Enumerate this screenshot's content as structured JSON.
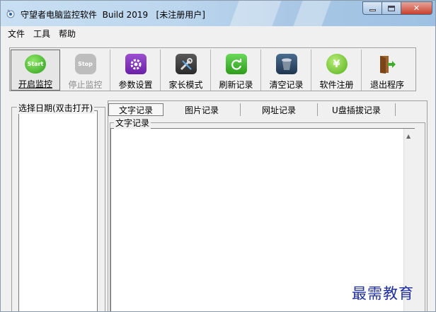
{
  "window": {
    "title": "守望者电脑监控软件  Build 2019   [未注册用户]"
  },
  "menu": [
    "文件",
    "工具",
    "帮助"
  ],
  "toolbar": [
    {
      "id": "start",
      "label": "开启监控",
      "icon_text": "Start",
      "icon": "start-icon"
    },
    {
      "id": "stop",
      "label": "停止监控",
      "icon_text": "Stop",
      "icon": "stop-icon"
    },
    {
      "id": "settings",
      "label": "参数设置",
      "icon": "gear-icon"
    },
    {
      "id": "parent",
      "label": "家长模式",
      "icon": "tools-icon"
    },
    {
      "id": "refresh",
      "label": "刷新记录",
      "icon": "refresh-icon"
    },
    {
      "id": "clear",
      "label": "清空记录",
      "icon": "trash-icon"
    },
    {
      "id": "register",
      "label": "软件注册",
      "icon_text": "¥",
      "icon": "yen-icon"
    },
    {
      "id": "exit",
      "label": "退出程序",
      "icon": "exit-door-icon"
    }
  ],
  "left_panel": {
    "title": "选择日期(双击打开)"
  },
  "tabs": [
    "文字记录",
    "图片记录",
    "网址记录",
    "U盘插拔记录"
  ],
  "content_group": {
    "title": "文字记录"
  },
  "watermark": "最需教育",
  "colors": {
    "title_bar": "#bcd6ee",
    "close_button": "#c8402b",
    "watermark": "#1f2fa0"
  }
}
